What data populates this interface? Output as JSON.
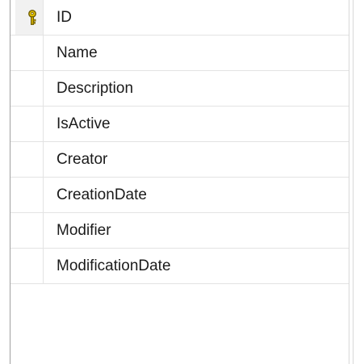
{
  "table": {
    "columns": [
      {
        "name": "ID",
        "is_primary_key": true
      },
      {
        "name": "Name",
        "is_primary_key": false
      },
      {
        "name": "Description",
        "is_primary_key": false
      },
      {
        "name": "IsActive",
        "is_primary_key": false
      },
      {
        "name": "Creator",
        "is_primary_key": false
      },
      {
        "name": "CreationDate",
        "is_primary_key": false
      },
      {
        "name": "Modifier",
        "is_primary_key": false
      },
      {
        "name": "ModificationDate",
        "is_primary_key": false
      }
    ],
    "key_icon": "primary-key-icon",
    "colors": {
      "key_fill": "#e8c400",
      "key_outline": "#6b5a00",
      "gutter": "#f1f1f1",
      "grid_line": "#e3e3e3",
      "border": "#a0a0a0"
    }
  }
}
